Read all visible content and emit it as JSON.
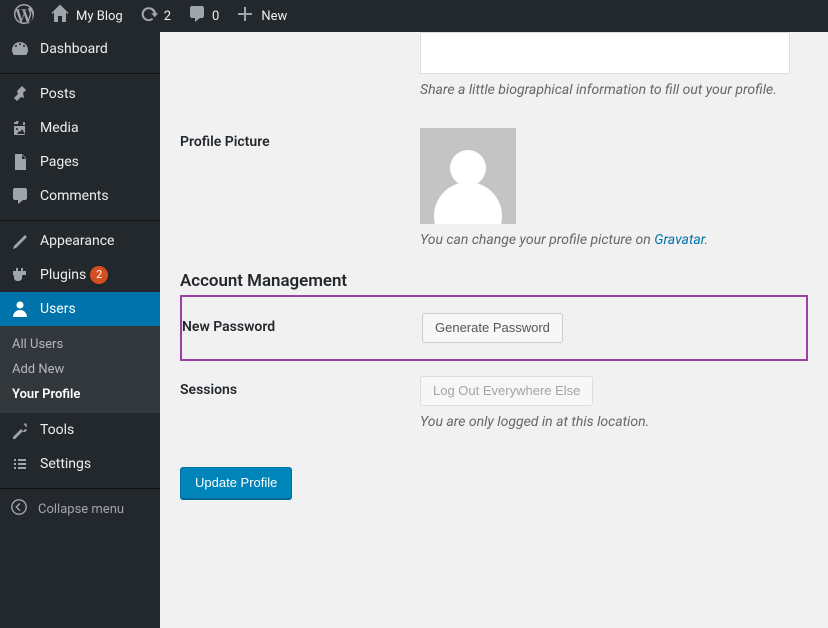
{
  "adminbar": {
    "site_name": "My Blog",
    "updates_count": "2",
    "comments_count": "0",
    "new_label": "New"
  },
  "menu": {
    "dashboard": "Dashboard",
    "posts": "Posts",
    "media": "Media",
    "pages": "Pages",
    "comments": "Comments",
    "appearance": "Appearance",
    "plugins": "Plugins",
    "plugins_count": "2",
    "users": "Users",
    "tools": "Tools",
    "settings": "Settings",
    "collapse": "Collapse menu"
  },
  "users_sub": {
    "all": "All Users",
    "add": "Add New",
    "profile": "Your Profile"
  },
  "profile": {
    "bio_desc": "Share a little biographical information to fill out your profile.",
    "picture_label": "Profile Picture",
    "picture_desc_pre": "You can change your profile picture on ",
    "picture_desc_link": "Gravatar",
    "picture_desc_post": ".",
    "account_heading": "Account Management",
    "newpass_label": "New Password",
    "generate_btn": "Generate Password",
    "sessions_label": "Sessions",
    "logout_btn": "Log Out Everywhere Else",
    "sessions_desc": "You are only logged in at this location.",
    "submit_btn": "Update Profile"
  }
}
